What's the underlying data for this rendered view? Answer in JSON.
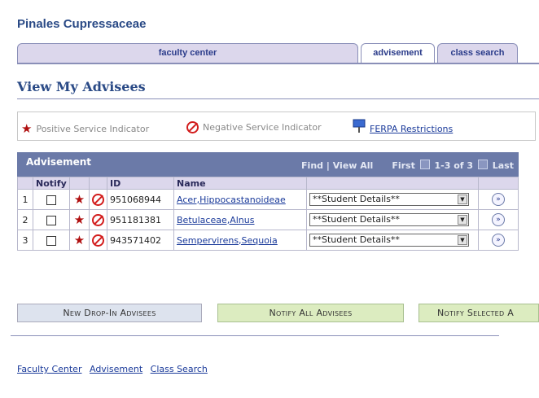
{
  "header": {
    "name": "Pinales Cupressaceae"
  },
  "tabs": [
    {
      "label": "faculty center"
    },
    {
      "label": "advisement"
    },
    {
      "label": "class search"
    }
  ],
  "page": {
    "title": "View My Advisees"
  },
  "legend": {
    "positive": "Positive Service Indicator",
    "negative": "Negative Service Indicator",
    "ferpa": "FERPA Restrictions"
  },
  "grid": {
    "title": "Advisement",
    "find": "Find",
    "view_all": "View All",
    "first": "First",
    "range": "1-3 of 3",
    "last": "Last",
    "columns": [
      "Notify",
      "ID",
      "Name"
    ],
    "rows": [
      {
        "num": "1",
        "id": "951068944",
        "name": "Acer,Hippocastanoideae",
        "option": "**Student Details**"
      },
      {
        "num": "2",
        "id": "951181381",
        "name": "Betulaceae,Alnus",
        "option": "**Student Details**"
      },
      {
        "num": "3",
        "id": "943571402",
        "name": "Sempervirens,Sequoia",
        "option": "**Student Details**"
      }
    ]
  },
  "buttons": {
    "new_dropin": "New Drop-In Advisees",
    "notify_all": "Notify All Advisees",
    "notify_selected": "Notify Selected A"
  },
  "footer": {
    "links": [
      "Faculty Center",
      "Advisement",
      "Class Search"
    ]
  }
}
